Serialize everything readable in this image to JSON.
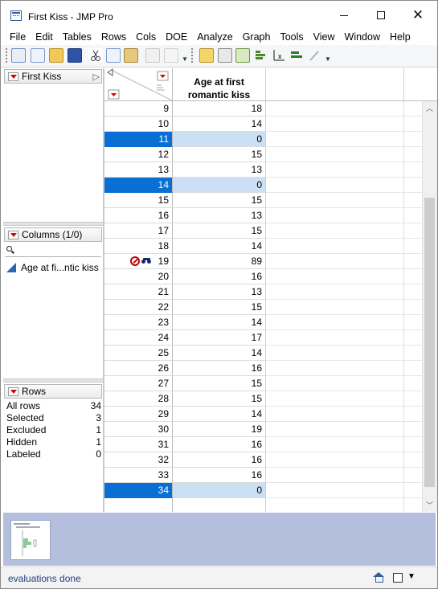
{
  "window": {
    "title": "First Kiss - JMP Pro",
    "min_glyph": "",
    "max_glyph": "",
    "close_glyph": "✕"
  },
  "menu": [
    "File",
    "Edit",
    "Tables",
    "Rows",
    "Cols",
    "DOE",
    "Analyze",
    "Graph",
    "Tools",
    "View",
    "Window",
    "Help"
  ],
  "toolbar": {
    "icons": [
      "new-data-table-icon",
      "new-script-icon",
      "open-icon",
      "save-icon",
      "cut-icon",
      "copy-icon",
      "paste-icon",
      "copy-special-icon",
      "lock-icon",
      "data-table-icon",
      "table-view-icon",
      "tabulate-icon",
      "distribution-icon",
      "fit-y-by-x-icon",
      "fit-model-icon",
      "annotate-icon"
    ]
  },
  "table_panel": {
    "title": "First Kiss"
  },
  "columns_panel": {
    "title": "Columns (1/0)",
    "items": [
      {
        "label": "Age at fi...ntic kiss",
        "icon": "continuous-column-icon"
      }
    ]
  },
  "rows_panel": {
    "title": "Rows",
    "stats": [
      {
        "label": "All rows",
        "value": "34"
      },
      {
        "label": "Selected",
        "value": "3"
      },
      {
        "label": "Excluded",
        "value": "1"
      },
      {
        "label": "Hidden",
        "value": "1"
      },
      {
        "label": "Labeled",
        "value": "0"
      }
    ]
  },
  "grid": {
    "column_header_line1": "Age at first",
    "column_header_line2": "romantic kiss",
    "rows": [
      {
        "n": "9",
        "v": "18",
        "selected": false
      },
      {
        "n": "10",
        "v": "14",
        "selected": false
      },
      {
        "n": "11",
        "v": "0",
        "selected": true
      },
      {
        "n": "12",
        "v": "15",
        "selected": false
      },
      {
        "n": "13",
        "v": "13",
        "selected": false
      },
      {
        "n": "14",
        "v": "0",
        "selected": true
      },
      {
        "n": "15",
        "v": "15",
        "selected": false
      },
      {
        "n": "16",
        "v": "13",
        "selected": false
      },
      {
        "n": "17",
        "v": "15",
        "selected": false
      },
      {
        "n": "18",
        "v": "14",
        "selected": false
      },
      {
        "n": "19",
        "v": "89",
        "selected": false,
        "excluded": true,
        "hidden": true
      },
      {
        "n": "20",
        "v": "16",
        "selected": false
      },
      {
        "n": "21",
        "v": "13",
        "selected": false
      },
      {
        "n": "22",
        "v": "15",
        "selected": false
      },
      {
        "n": "23",
        "v": "14",
        "selected": false
      },
      {
        "n": "24",
        "v": "17",
        "selected": false
      },
      {
        "n": "25",
        "v": "14",
        "selected": false
      },
      {
        "n": "26",
        "v": "16",
        "selected": false
      },
      {
        "n": "27",
        "v": "15",
        "selected": false
      },
      {
        "n": "28",
        "v": "15",
        "selected": false
      },
      {
        "n": "29",
        "v": "14",
        "selected": false
      },
      {
        "n": "30",
        "v": "19",
        "selected": false
      },
      {
        "n": "31",
        "v": "16",
        "selected": false
      },
      {
        "n": "32",
        "v": "16",
        "selected": false
      },
      {
        "n": "33",
        "v": "16",
        "selected": false
      },
      {
        "n": "34",
        "v": "0",
        "selected": true
      },
      {
        "n": "",
        "v": "",
        "selected": false
      }
    ]
  },
  "status": {
    "text": "evaluations done"
  },
  "colors": {
    "selection": "#0a6fd3",
    "selected_cell": "#cce0f5",
    "thumb_area": "#b4bfdd",
    "red_triangle": "#d20000"
  }
}
